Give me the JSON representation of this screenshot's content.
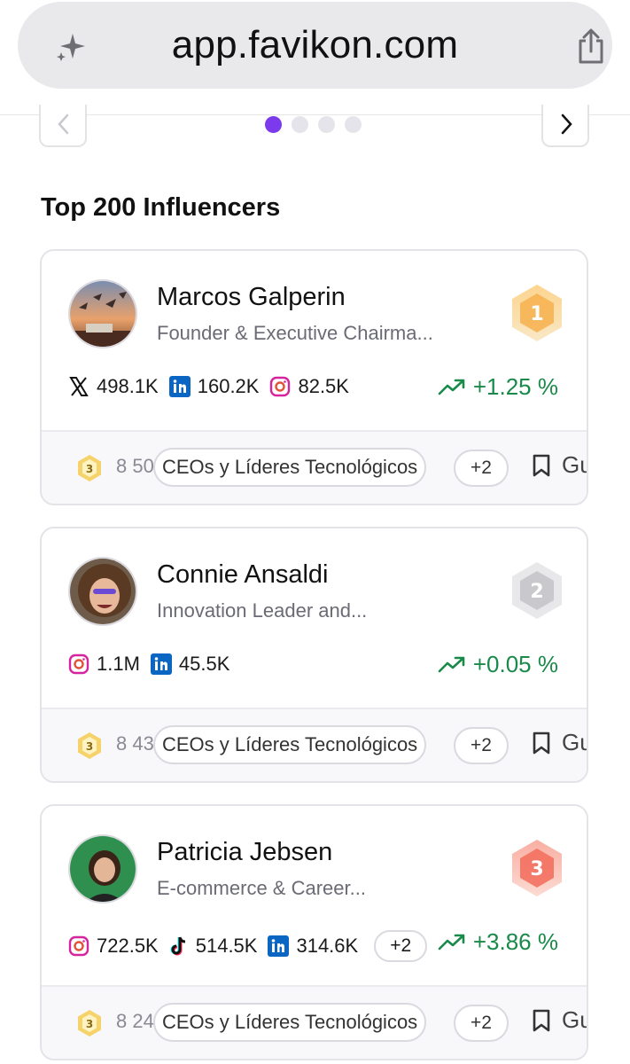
{
  "browser": {
    "url": "app.favikon.com"
  },
  "carousel": {
    "dots": 4,
    "active_dot": 0
  },
  "section": {
    "title": "Top 200 Influencers"
  },
  "colors": {
    "accent": "#7c3aed",
    "growth": "#1a8a4a"
  },
  "influencers": [
    {
      "name": "Marcos Galperin",
      "role": "Founder & Executive Chairma...",
      "rank": "1",
      "rank_color": "#f5a623",
      "stats": [
        {
          "icon": "x-icon",
          "value": "498.1K"
        },
        {
          "icon": "linkedin-icon",
          "value": "160.2K"
        },
        {
          "icon": "instagram-icon",
          "value": "82.5K"
        }
      ],
      "more_networks": "",
      "growth": "+1.25 %",
      "level": "3",
      "score": "8 50",
      "category": "CEOs y Líderes Tecnológicos",
      "more_categories": "+2",
      "save_label": "Guard"
    },
    {
      "name": "Connie Ansaldi",
      "role": "Innovation Leader and...",
      "rank": "2",
      "rank_color": "#b8b8bc",
      "stats": [
        {
          "icon": "instagram-icon",
          "value": "1.1M"
        },
        {
          "icon": "linkedin-icon",
          "value": "45.5K"
        }
      ],
      "more_networks": "",
      "growth": "+0.05 %",
      "level": "3",
      "score": "8 43",
      "category": "CEOs y Líderes Tecnológicos",
      "more_categories": "+2",
      "save_label": "Guard"
    },
    {
      "name": "Patricia Jebsen",
      "role": "E-commerce & Career...",
      "rank": "3",
      "rank_color": "#f26b5b",
      "stats": [
        {
          "icon": "instagram-icon",
          "value": "722.5K"
        },
        {
          "icon": "tiktok-icon",
          "value": "514.5K"
        },
        {
          "icon": "linkedin-icon",
          "value": "314.6K"
        }
      ],
      "more_networks": "+2",
      "growth": "+3.86 %",
      "level": "3",
      "score": "8 24",
      "category": "CEOs y Líderes Tecnológicos",
      "more_categories": "+2",
      "save_label": "Guard"
    }
  ]
}
